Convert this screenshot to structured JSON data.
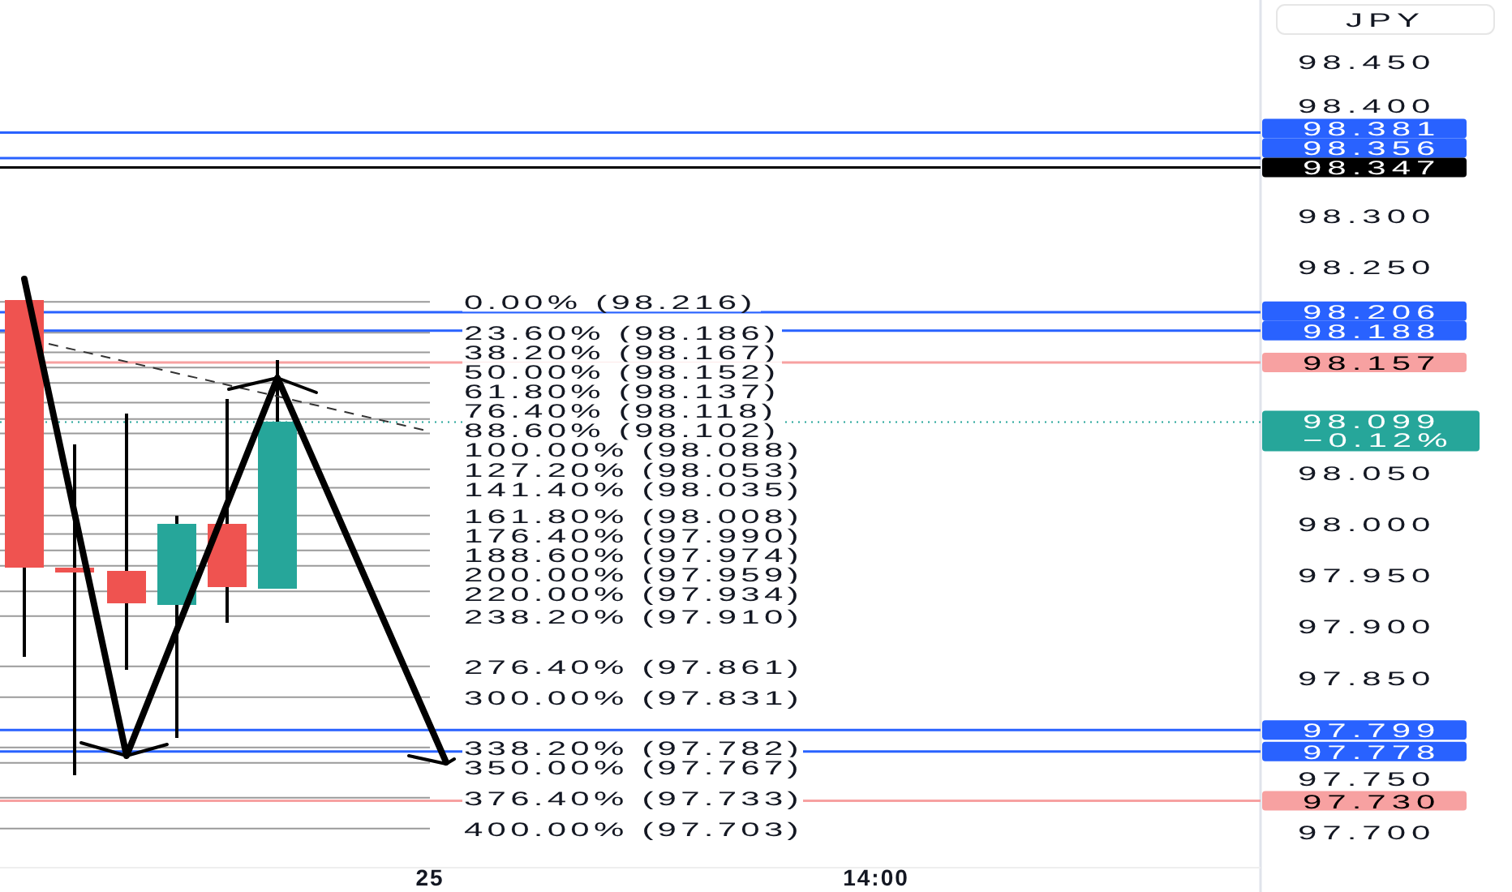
{
  "currency_button": "JPY",
  "price_ticks": [
    "98.450",
    "98.400",
    "98.300",
    "98.250",
    "98.050",
    "98.000",
    "97.950",
    "97.900",
    "97.850",
    "97.750",
    "97.700"
  ],
  "price_tags": [
    {
      "kind": "level",
      "text": "98.381",
      "color": "#2962ff"
    },
    {
      "kind": "level",
      "text": "98.356",
      "color": "#2962ff"
    },
    {
      "kind": "level",
      "text": "98.347",
      "color": "#000000"
    },
    {
      "kind": "level",
      "text": "98.206",
      "color": "#2962ff"
    },
    {
      "kind": "level",
      "text": "98.188",
      "color": "#2962ff"
    },
    {
      "kind": "level",
      "text": "98.157",
      "color": "#f7a1a1"
    },
    {
      "kind": "last_price",
      "text": "98.099",
      "change": "−0.12%",
      "color": "#26a69a"
    },
    {
      "kind": "level",
      "text": "97.799",
      "color": "#2962ff"
    },
    {
      "kind": "level",
      "text": "97.778",
      "color": "#2962ff"
    },
    {
      "kind": "level",
      "text": "97.730",
      "color": "#f7a1a1"
    }
  ],
  "fib_levels": [
    {
      "label": "0.00% (98.216)"
    },
    {
      "label": "23.60% (98.186)"
    },
    {
      "label": "38.20% (98.167)"
    },
    {
      "label": "50.00% (98.152)"
    },
    {
      "label": "61.80% (98.137)"
    },
    {
      "label": "76.40% (98.118)"
    },
    {
      "label": "88.60% (98.102)"
    },
    {
      "label": "100.00% (98.088)"
    },
    {
      "label": "127.20% (98.053)"
    },
    {
      "label": "141.40% (98.035)"
    },
    {
      "label": "161.80% (98.008)"
    },
    {
      "label": "176.40% (97.990)"
    },
    {
      "label": "188.60% (97.974)"
    },
    {
      "label": "200.00% (97.959)"
    },
    {
      "label": "220.00% (97.934)"
    },
    {
      "label": "238.20% (97.910)"
    },
    {
      "label": "276.40% (97.861)"
    },
    {
      "label": "300.00% (97.831)"
    },
    {
      "label": "338.20% (97.782)"
    },
    {
      "label": "350.00% (97.767)"
    },
    {
      "label": "376.40% (97.733)"
    },
    {
      "label": "400.00% (97.703)"
    }
  ],
  "time_labels": [
    "25",
    "14:00"
  ]
}
